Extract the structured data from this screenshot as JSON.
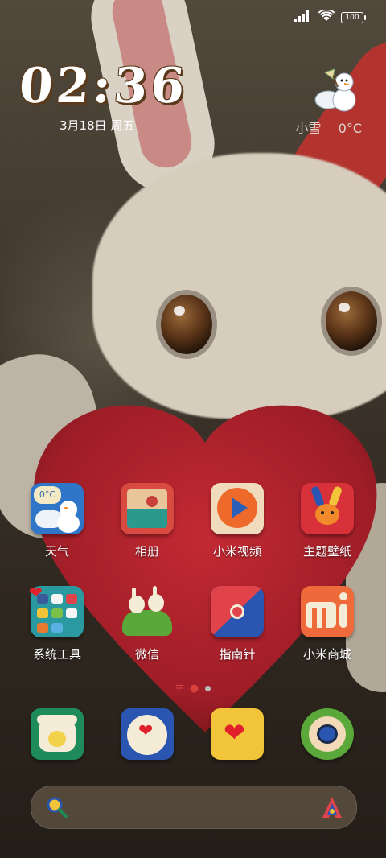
{
  "status_bar": {
    "signal_icon": "signal-icon",
    "wifi_icon": "wifi-icon",
    "battery": "100"
  },
  "lockclock": {
    "time": "02:36",
    "date": "3月18日 周五"
  },
  "weather": {
    "icon": "snowman-icon",
    "condition": "小雪",
    "temperature": "0°C"
  },
  "home_apps": [
    {
      "label": "天气",
      "icon": "weather-snowman-icon"
    },
    {
      "label": "相册",
      "icon": "gallery-icon"
    },
    {
      "label": "小米视频",
      "icon": "video-play-icon"
    },
    {
      "label": "主题壁纸",
      "icon": "themes-bunny-icon"
    },
    {
      "label": "系统工具",
      "icon": "tools-folder-icon"
    },
    {
      "label": "微信",
      "icon": "wechat-bunnies-icon"
    },
    {
      "label": "指南针",
      "icon": "compass-icon"
    },
    {
      "label": "小米商城",
      "icon": "mi-store-icon"
    }
  ],
  "dock": [
    {
      "icon": "phone-icon"
    },
    {
      "icon": "messages-icon"
    },
    {
      "icon": "browser-heart-icon"
    },
    {
      "icon": "camera-icon"
    }
  ],
  "page_indicator": {
    "pages": 2,
    "current": 1
  },
  "search": {
    "left_icon": "search-lens-icon",
    "right_icon": "assistant-icon"
  },
  "colors": {
    "heart": "#b0202a",
    "text": "#ffffff",
    "clock_outline": "#5a3a1a"
  }
}
